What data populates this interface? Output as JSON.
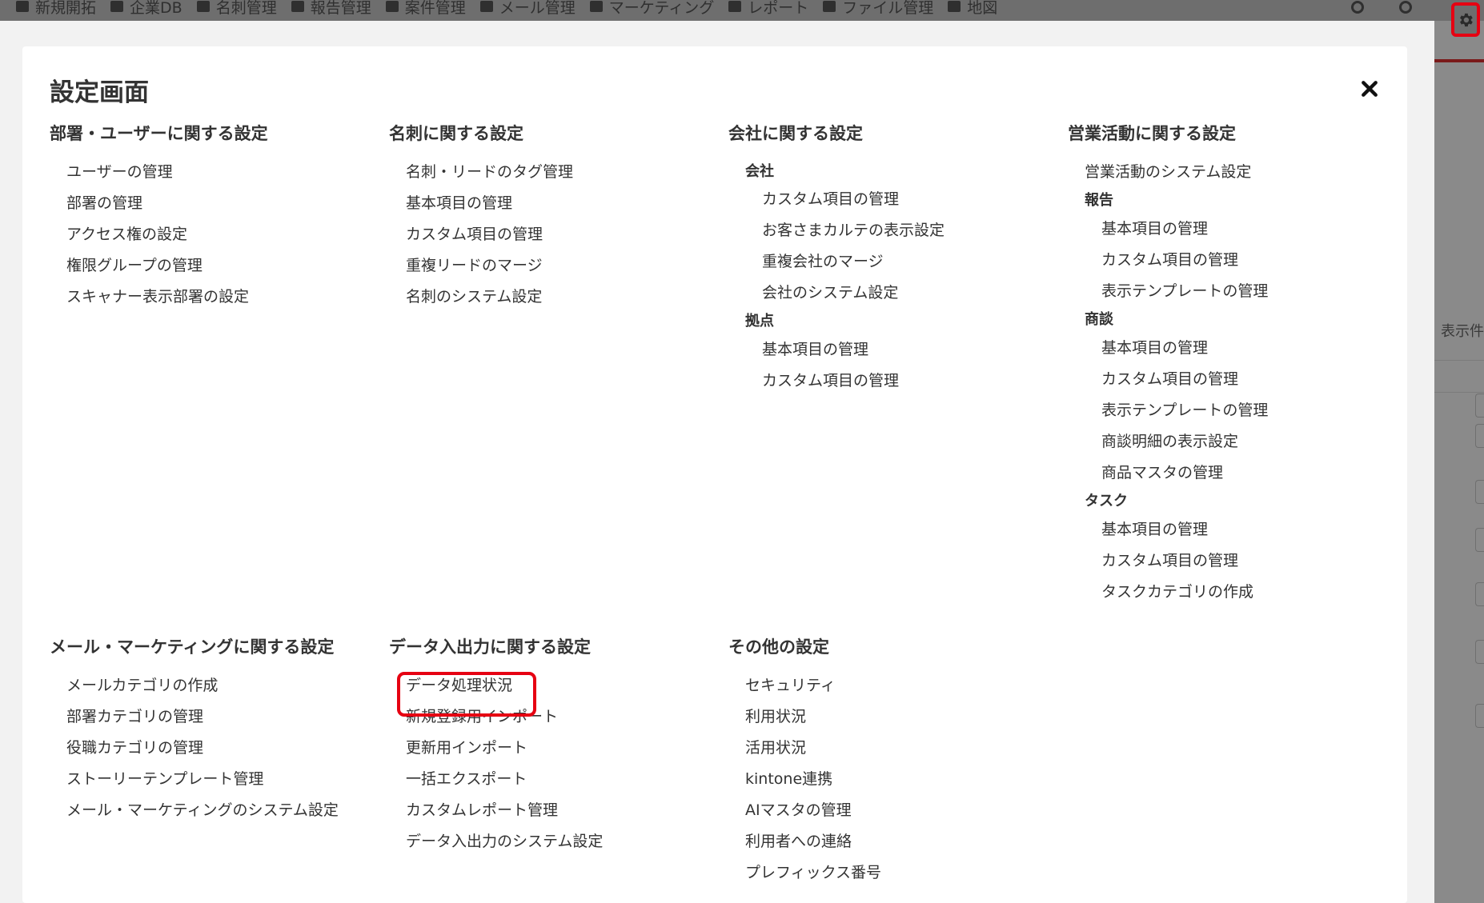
{
  "topbar": {
    "items": [
      "新規開拓",
      "企業DB",
      "名刺管理",
      "報告管理",
      "案件管理",
      "メール管理",
      "マーケティング",
      "レポート",
      "ファイル管理",
      "地図"
    ]
  },
  "background": {
    "side_text": "表示件"
  },
  "modal": {
    "title": "設定画面"
  },
  "sections": {
    "dept_user": {
      "heading": "部署・ユーザーに関する設定",
      "items": [
        "ユーザーの管理",
        "部署の管理",
        "アクセス権の設定",
        "権限グループの管理",
        "スキャナー表示部署の設定"
      ]
    },
    "card": {
      "heading": "名刺に関する設定",
      "items": [
        "名刺・リードのタグ管理",
        "基本項目の管理",
        "カスタム項目の管理",
        "重複リードのマージ",
        "名刺のシステム設定"
      ]
    },
    "company": {
      "heading": "会社に関する設定",
      "groups": [
        {
          "label": "会社",
          "items": [
            "カスタム項目の管理",
            "お客さまカルテの表示設定",
            "重複会社のマージ",
            "会社のシステム設定"
          ]
        },
        {
          "label": "拠点",
          "items": [
            "基本項目の管理",
            "カスタム項目の管理"
          ]
        }
      ]
    },
    "sales": {
      "heading": "営業活動に関する設定",
      "top_item": "営業活動のシステム設定",
      "groups": [
        {
          "label": "報告",
          "items": [
            "基本項目の管理",
            "カスタム項目の管理",
            "表示テンプレートの管理"
          ]
        },
        {
          "label": "商談",
          "items": [
            "基本項目の管理",
            "カスタム項目の管理",
            "表示テンプレートの管理",
            "商談明細の表示設定",
            "商品マスタの管理"
          ]
        },
        {
          "label": "タスク",
          "items": [
            "基本項目の管理",
            "カスタム項目の管理",
            "タスクカテゴリの作成"
          ]
        }
      ]
    },
    "mail": {
      "heading": "メール・マーケティングに関する設定",
      "items": [
        "メールカテゴリの作成",
        "部署カテゴリの管理",
        "役職カテゴリの管理",
        "ストーリーテンプレート管理",
        "メール・マーケティングのシステム設定"
      ]
    },
    "data": {
      "heading": "データ入出力に関する設定",
      "items": [
        "データ処理状況",
        "新規登録用インポート",
        "更新用インポート",
        "一括エクスポート",
        "カスタムレポート管理",
        "データ入出力のシステム設定"
      ]
    },
    "other": {
      "heading": "その他の設定",
      "items": [
        "セキュリティ",
        "利用状況",
        "活用状況",
        "kintone連携",
        "AIマスタの管理",
        "利用者への連絡",
        "プレフィックス番号"
      ]
    }
  },
  "colors": {
    "highlight": "#e60012",
    "overlay": "#8a8a8a",
    "modal_bg": "#ffffff"
  }
}
